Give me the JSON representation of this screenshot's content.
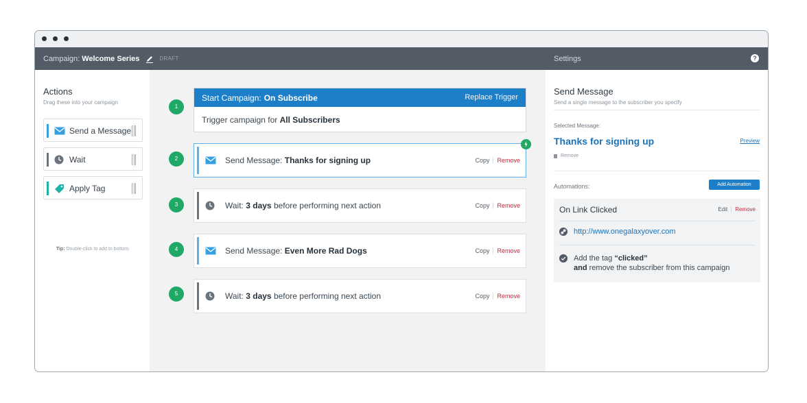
{
  "header": {
    "campaign_label": "Campaign:",
    "campaign_name": "Welcome Series",
    "status": "DRAFT",
    "settings_label": "Settings",
    "help_glyph": "?"
  },
  "actions_panel": {
    "title": "Actions",
    "subtitle": "Drag these into your campaign",
    "items": [
      {
        "label": "Send a Message",
        "icon": "envelope-icon",
        "color": "#36a0e0"
      },
      {
        "label": "Wait",
        "icon": "clock-icon",
        "color": "#6b747c"
      },
      {
        "label": "Apply Tag",
        "icon": "tag-icon",
        "color": "#1fb3a8"
      }
    ],
    "tip_label": "Tip:",
    "tip_text": "Double-click to add to bottom"
  },
  "workflow": {
    "trigger": {
      "number": "1",
      "title_prefix": "Start Campaign:",
      "title_value": "On Subscribe",
      "replace_label": "Replace Trigger",
      "body_prefix": "Trigger campaign for",
      "body_value": "All Subscribers"
    },
    "steps": [
      {
        "number": "2",
        "prefix": "Send Message:",
        "bold": "Thanks for signing up",
        "suffix": "",
        "copy": "Copy",
        "remove": "Remove"
      },
      {
        "number": "3",
        "prefix": "Wait:",
        "bold": "3 days",
        "suffix": "before performing next action",
        "copy": "Copy",
        "remove": "Remove"
      },
      {
        "number": "4",
        "prefix": "Send Message:",
        "bold": "Even More Rad Dogs",
        "suffix": "",
        "copy": "Copy",
        "remove": "Remove"
      },
      {
        "number": "5",
        "prefix": "Wait:",
        "bold": "3 days",
        "suffix": "before performing next action",
        "copy": "Copy",
        "remove": "Remove"
      }
    ]
  },
  "details": {
    "title": "Send Message",
    "subtitle": "Send a single message to the subscriber you specify",
    "selected_label": "Selected Message:",
    "selected_message": "Thanks for signing up",
    "preview_label": "Preview",
    "remove_label": "Remove",
    "automations_label": "Automations:",
    "add_automation_label": "Add Automation",
    "automation": {
      "title": "On Link Clicked",
      "edit_label": "Edit",
      "remove_label": "Remove",
      "link": "http://www.onegalaxyover.com",
      "action_prefix": "Add the tag",
      "action_tag": "“clicked”",
      "action_and": "and",
      "action_suffix": "remove the subscriber from this campaign"
    }
  },
  "colors": {
    "header_bg": "#535c66",
    "accent_blue": "#1e7fc9",
    "step_green": "#1fa866",
    "remove_red": "#c0283d"
  }
}
